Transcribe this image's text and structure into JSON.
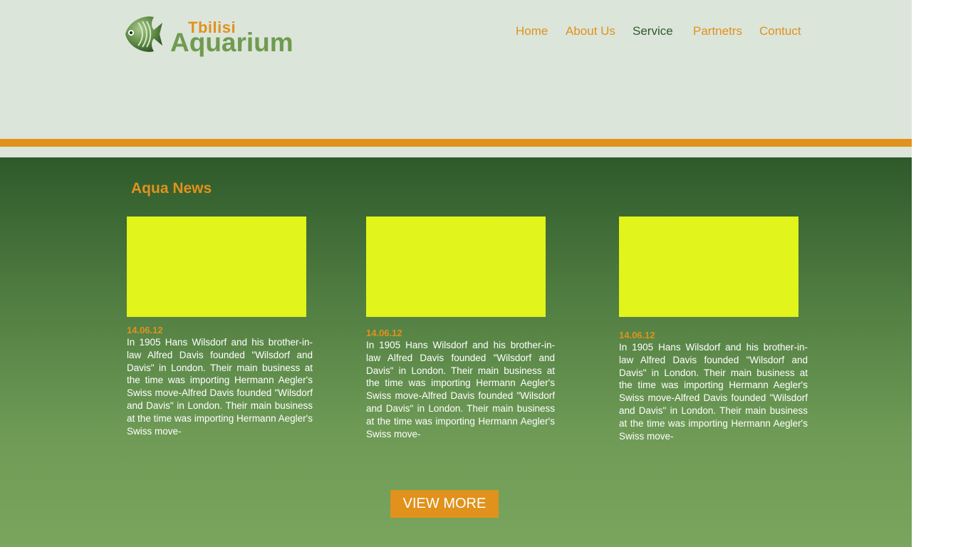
{
  "brand": {
    "top": "Tbilisi",
    "bottom": "Aquarium",
    "icon": "fish-icon"
  },
  "nav": {
    "items": [
      {
        "label": "Home",
        "active": false
      },
      {
        "label": "About Us",
        "active": false
      },
      {
        "label": "Service",
        "active": true
      },
      {
        "label": "Partnetrs",
        "active": false
      },
      {
        "label": "Contuct",
        "active": false
      }
    ]
  },
  "news": {
    "title": "Aqua News",
    "items": [
      {
        "date": "14.06.12",
        "text": "In 1905 Hans Wilsdorf and his brother-in-law Alfred Davis founded \"Wilsdorf and Davis\" in London. Their main business at the time was importing Hermann Aegler's Swiss move-Alfred Davis founded \"Wilsdorf and Davis\" in London. Their main business at the time was importing Hermann Aegler's Swiss move-"
      },
      {
        "date": "14.06.12",
        "text": "In 1905 Hans Wilsdorf and his brother-in-law Alfred Davis founded \"Wilsdorf and Davis\" in London. Their main business at the time was importing Hermann Aegler's Swiss move-Alfred Davis founded \"Wilsdorf and Davis\" in London. Their main business at the time was importing Hermann Aegler's Swiss move-"
      },
      {
        "date": "14.06.12",
        "text": "In 1905 Hans Wilsdorf and his brother-in-law Alfred Davis founded \"Wilsdorf and Davis\" in London. Their main business at the time was importing Hermann Aegler's Swiss move-Alfred Davis founded \"Wilsdorf and Davis\" in London. Their main business at the time was importing Hermann Aegler's Swiss move-"
      }
    ],
    "view_more": "VIEW MORE"
  },
  "colors": {
    "accent": "#e0921c",
    "header_bg": "#dce5da",
    "dark_green": "#2e5a2b",
    "image_placeholder": "#e1f41b"
  }
}
